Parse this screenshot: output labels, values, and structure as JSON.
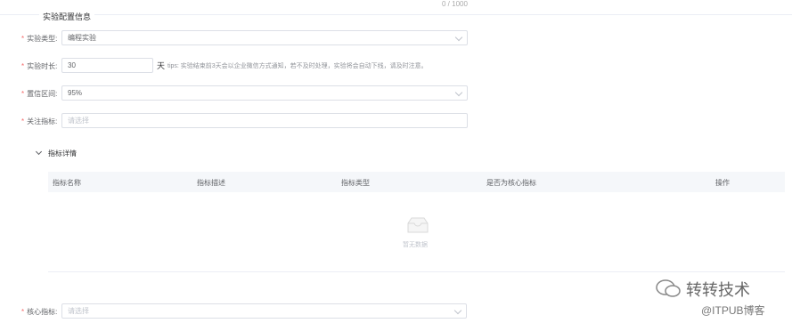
{
  "counter": "0 / 1000",
  "section": {
    "title": "实验配置信息"
  },
  "form": {
    "type": {
      "label": "实验类型:",
      "value": "编程实验"
    },
    "duration": {
      "label": "实验时长:",
      "value": "30",
      "unit": "天",
      "tips": "tips: 实验结束前3天会以企业微信方式通知，若不及时处理，实验将会自动下线，请及时注意。"
    },
    "confidence": {
      "label": "置信区间:",
      "value": "95%"
    },
    "metrics": {
      "label": "关注指标:",
      "placeholder": "请选择"
    },
    "core": {
      "label": "核心指标:",
      "placeholder": "请选择"
    }
  },
  "details": {
    "title": "指标详情",
    "columns": [
      "指标名称",
      "指标描述",
      "指标类型",
      "是否为核心指标",
      "操作"
    ],
    "empty_text": "暂无数据"
  },
  "watermark": {
    "line1": "转转技术",
    "line2": "@ITPUB博客"
  }
}
